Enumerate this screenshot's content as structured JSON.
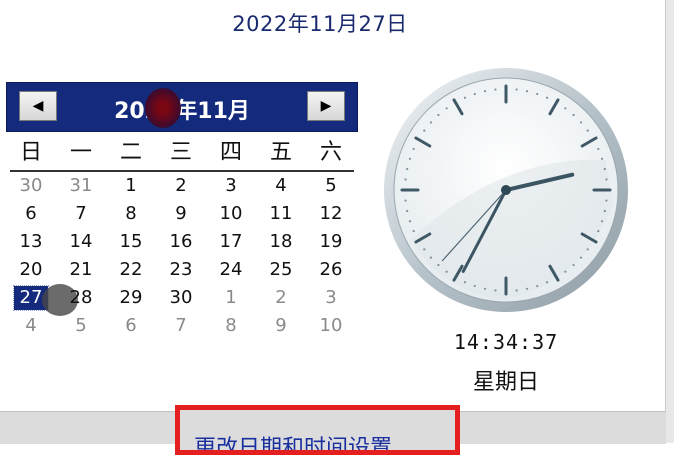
{
  "header": {
    "date": "2022年11月27日"
  },
  "calendar": {
    "title": "2022年11月",
    "prev_symbol": "◀",
    "next_symbol": "▶",
    "weekdays": [
      "日",
      "一",
      "二",
      "三",
      "四",
      "五",
      "六"
    ],
    "weeks": [
      [
        "30",
        "31",
        "1",
        "2",
        "3",
        "4",
        "5"
      ],
      [
        "6",
        "7",
        "8",
        "9",
        "10",
        "11",
        "12"
      ],
      [
        "13",
        "14",
        "15",
        "16",
        "17",
        "18",
        "19"
      ],
      [
        "20",
        "21",
        "22",
        "23",
        "24",
        "25",
        "26"
      ],
      [
        "27",
        "28",
        "29",
        "30",
        "1",
        "2",
        "3"
      ],
      [
        "4",
        "5",
        "6",
        "7",
        "8",
        "9",
        "10"
      ]
    ],
    "selected_day": "27"
  },
  "clock": {
    "time": "14:34:37",
    "weekday": "星期日",
    "hours": 14,
    "minutes": 34,
    "seconds": 37
  },
  "footer": {
    "link_label": "更改日期和时间设置..."
  },
  "colors": {
    "nav_bg": "#142a7c",
    "link": "#1a2f9e",
    "highlight_border": "#e3201f"
  }
}
